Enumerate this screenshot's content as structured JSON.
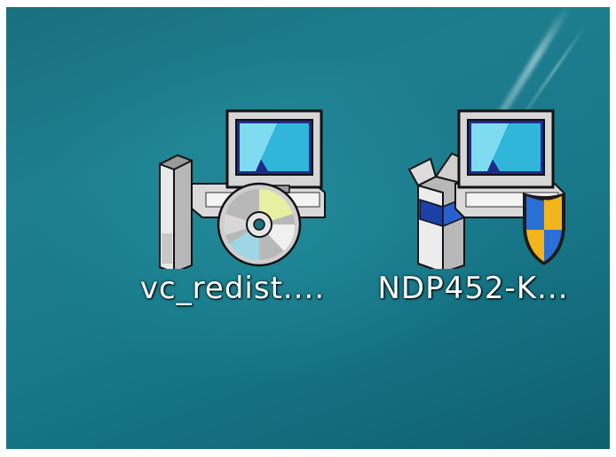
{
  "desktop": {
    "icons": [
      {
        "label": "vc_redist....",
        "icon": "installer-cd-icon"
      },
      {
        "label": "NDP452-K...",
        "icon": "installer-shield-icon"
      }
    ]
  },
  "colors": {
    "wallpaper": "#1d7f8e",
    "label_text": "#ffffff",
    "shield_blue": "#2a6fd6",
    "shield_yellow": "#f2b51c"
  }
}
